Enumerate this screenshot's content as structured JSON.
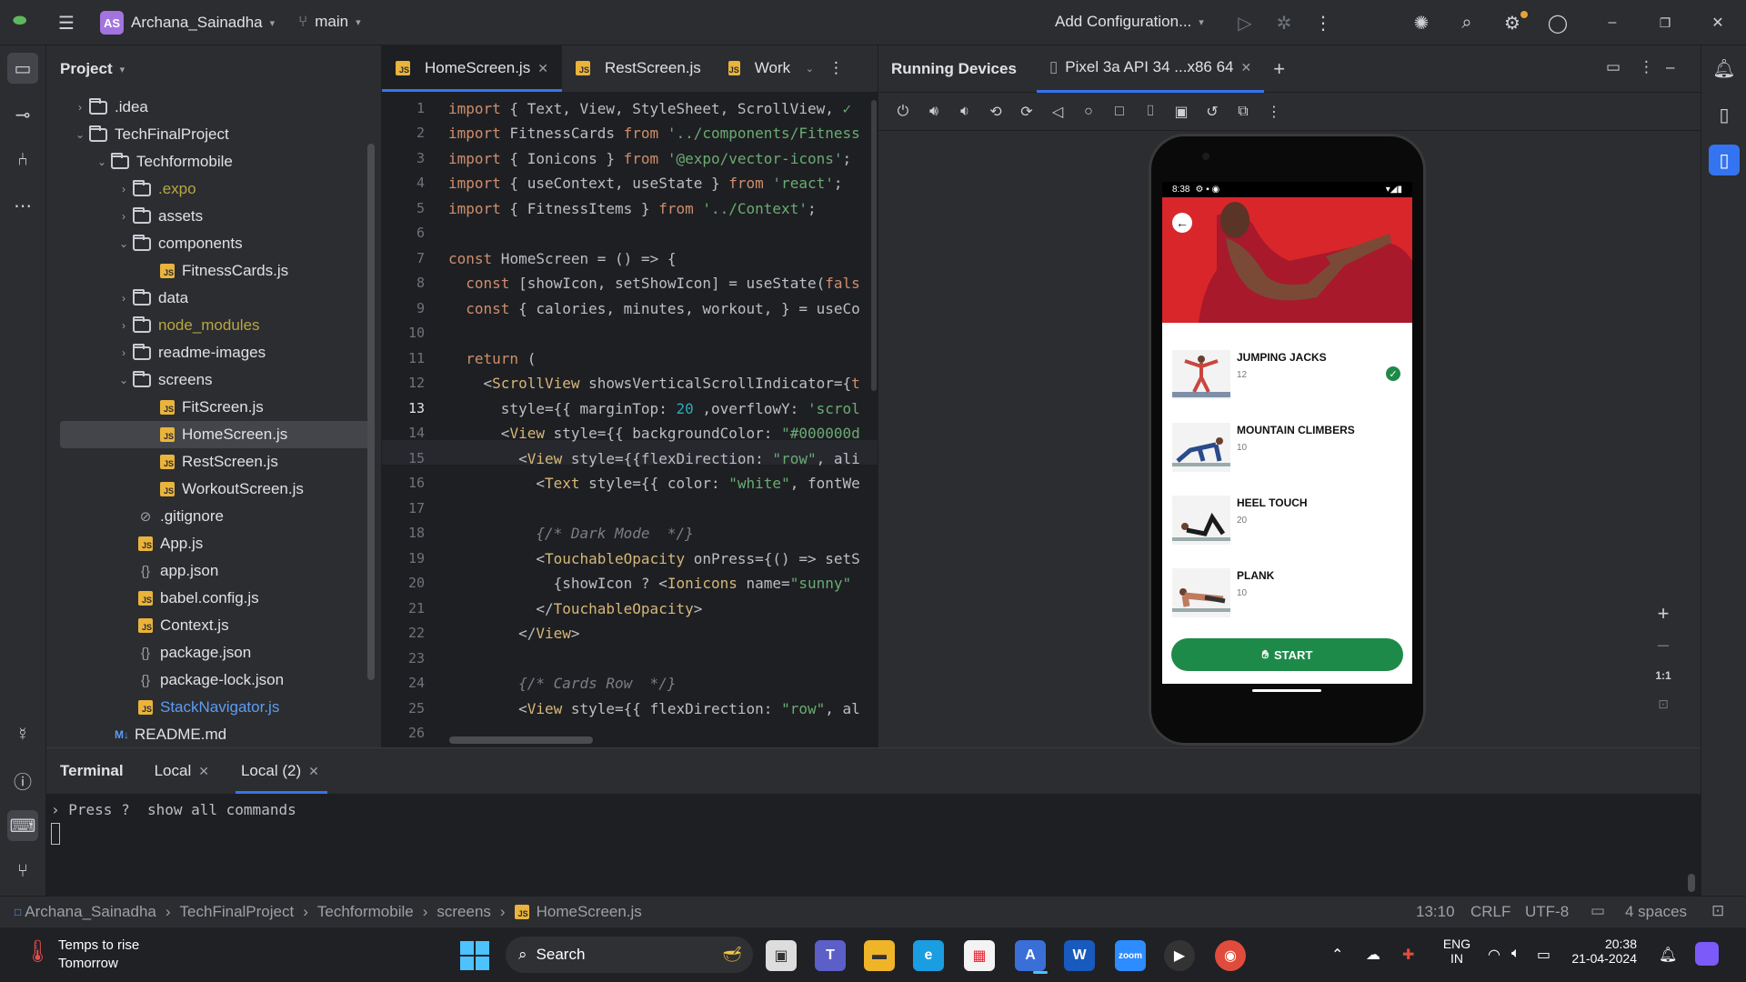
{
  "topbar": {
    "avatar_initials": "AS",
    "project_name": "Archana_Sainadha",
    "branch": "main",
    "run_config": "Add Configuration..."
  },
  "project_panel": {
    "title": "Project",
    "rows": [
      {
        "name": ".idea"
      },
      {
        "name": "TechFinalProject"
      },
      {
        "name": "Techformobile"
      },
      {
        "name": ".expo"
      },
      {
        "name": "assets"
      },
      {
        "name": "components"
      },
      {
        "name": "FitnessCards.js"
      },
      {
        "name": "data"
      },
      {
        "name": "node_modules"
      },
      {
        "name": "readme-images"
      },
      {
        "name": "screens"
      },
      {
        "name": "FitScreen.js"
      },
      {
        "name": "HomeScreen.js"
      },
      {
        "name": "RestScreen.js"
      },
      {
        "name": "WorkoutScreen.js"
      },
      {
        "name": ".gitignore"
      },
      {
        "name": "App.js"
      },
      {
        "name": "app.json"
      },
      {
        "name": "babel.config.js"
      },
      {
        "name": "Context.js"
      },
      {
        "name": "package.json"
      },
      {
        "name": "package-lock.json"
      },
      {
        "name": "StackNavigator.js"
      },
      {
        "name": "README.md"
      }
    ]
  },
  "editor": {
    "tabs": [
      "HomeScreen.js",
      "RestScreen.js",
      "Work"
    ],
    "line_numbers": [
      "1",
      "2",
      "3",
      "4",
      "5",
      "6",
      "7",
      "8",
      "9",
      "10",
      "11",
      "12",
      "13",
      "14",
      "15",
      "16",
      "17",
      "18",
      "19",
      "20",
      "21",
      "22",
      "23",
      "24",
      "25",
      "26"
    ]
  },
  "devices": {
    "title": "Running Devices",
    "device_tab": "Pixel 3a API 34 ...x86 64",
    "zoom_label": "1:1",
    "phone": {
      "time": "8:38",
      "exercises": [
        {
          "name": "JUMPING JACKS",
          "count": "12"
        },
        {
          "name": "MOUNTAIN CLIMBERS",
          "count": "10"
        },
        {
          "name": "HEEL TOUCH",
          "count": "20"
        },
        {
          "name": "PLANK",
          "count": "10"
        }
      ],
      "start_label": "START"
    }
  },
  "terminal": {
    "title": "Terminal",
    "tabs": [
      "Local",
      "Local (2)"
    ],
    "prompt_text": "Press ?  show all commands"
  },
  "statusbar": {
    "breadcrumb": [
      "Archana_Sainadha",
      "TechFinalProject",
      "Techformobile",
      "screens",
      "HomeScreen.js"
    ],
    "position": "13:10",
    "line_sep": "CRLF",
    "encoding": "UTF-8",
    "indent": "4 spaces"
  },
  "taskbar": {
    "weather_title": "Temps to rise",
    "weather_sub": "Tomorrow",
    "search_label": "Search",
    "lang_top": "ENG",
    "lang_bottom": "IN",
    "time": "20:38",
    "date": "21-04-2024"
  },
  "colors": {
    "accent": "#3574f0",
    "start_button": "#1e8a49",
    "hero": "#d9262a"
  }
}
